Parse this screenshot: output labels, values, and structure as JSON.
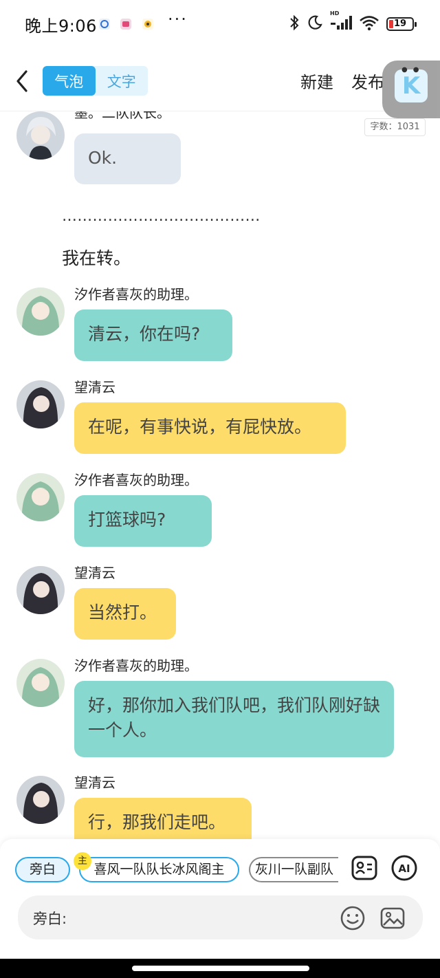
{
  "status_bar": {
    "time": "晚上9:06",
    "dots": "···",
    "battery": "19",
    "network_badge": "HD"
  },
  "header": {
    "tabs": [
      {
        "label": "气泡",
        "active": true
      },
      {
        "label": "文字",
        "active": false
      }
    ],
    "new_label": "新建",
    "publish_label": "发布",
    "word_count": "字数：1031"
  },
  "chat": {
    "top_partial": {
      "sender": "墨。二队队长。",
      "text": "Ok.",
      "style": "gray"
    },
    "narration_dots": "…………………………………",
    "narration_text": "我在转。",
    "messages": [
      {
        "sender": "汐作者喜灰的助理。",
        "text": "清云，你在吗?",
        "style": "teal",
        "avatar": "green-hair-avatar"
      },
      {
        "sender": "望清云",
        "text": "在呢，有事快说，有屁快放。",
        "style": "yellow",
        "avatar": "dark-hair-avatar"
      },
      {
        "sender": "汐作者喜灰的助理。",
        "text": "打篮球吗?",
        "style": "teal",
        "avatar": "green-hair-avatar"
      },
      {
        "sender": "望清云",
        "text": "当然打。",
        "style": "yellow",
        "avatar": "dark-hair-avatar"
      },
      {
        "sender": "汐作者喜灰的助理。",
        "text": "好，那你加入我们队吧，我们队刚好缺一个人。",
        "style": "teal",
        "avatar": "green-hair-avatar"
      },
      {
        "sender": "望清云",
        "text": "行，那我们走吧。",
        "style": "yellow",
        "avatar": "dark-hair-avatar"
      }
    ]
  },
  "bottom": {
    "chips": [
      {
        "label": "旁白",
        "selected": true
      },
      {
        "label": "喜风一队队长冰风阁主",
        "badge": "主"
      },
      {
        "label": "灰川一队副队"
      }
    ],
    "input_label": "旁白:",
    "input_value": "",
    "input_placeholder": ""
  },
  "colors": {
    "accent": "#29a8ea",
    "bubble_teal": "#87d8cf",
    "bubble_yellow": "#fedc6a",
    "bubble_gray": "#e2e8f0"
  }
}
